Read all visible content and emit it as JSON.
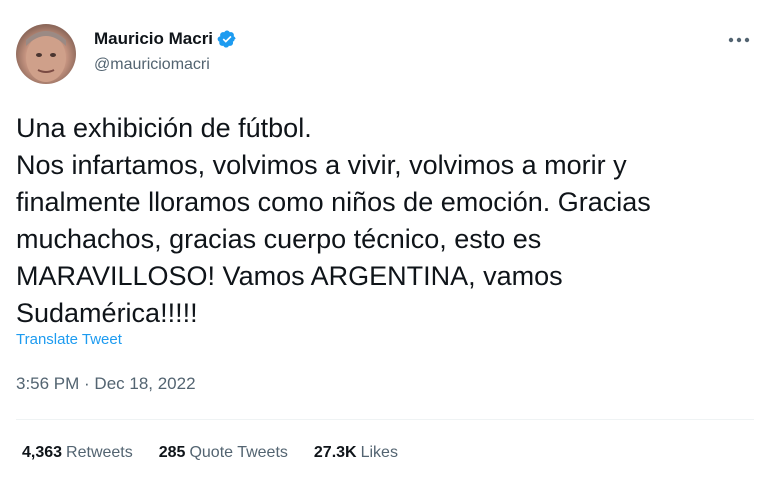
{
  "author": {
    "display_name": "Mauricio Macri",
    "handle": "@mauriciomacri",
    "verified_icon": "verified-badge-icon"
  },
  "more_icon": "more-horizontal-icon",
  "tweet": {
    "text": "Una exhibición de fútbol.\nNos infartamos, volvimos a vivir, volvimos a morir y finalmente lloramos como niños de emoción. Gracias muchachos, gracias cuerpo técnico, esto es MARAVILLOSO! Vamos ARGENTINA, vamos Sudamérica!!!!!",
    "translate_label": "Translate Tweet",
    "timestamp": "3:56 PM · Dec 18, 2022"
  },
  "stats": {
    "retweets_count": "4,363",
    "retweets_label": "Retweets",
    "quotes_count": "285",
    "quotes_label": "Quote Tweets",
    "likes_count": "27.3K",
    "likes_label": "Likes"
  },
  "colors": {
    "link": "#1d9bf0",
    "secondary_text": "#536471",
    "primary_text": "#0f1419"
  }
}
